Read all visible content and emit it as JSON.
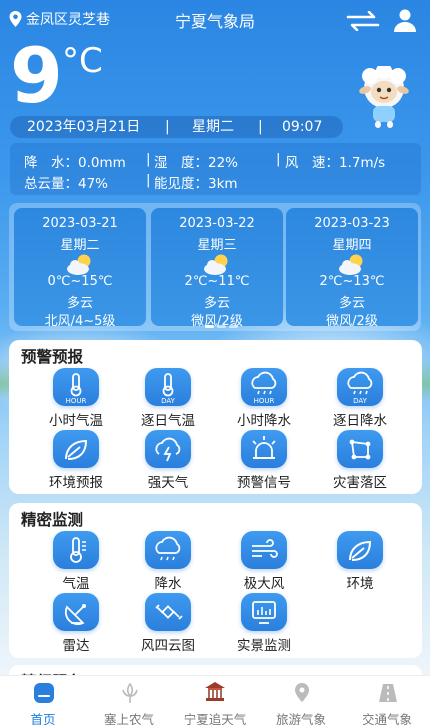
{
  "header": {
    "location": "金凤区灵芝巷",
    "title": "宁夏气象局"
  },
  "current": {
    "temperature": "9",
    "unit": "°C",
    "date": "2023年03月21日",
    "weekday": "星期二",
    "time": "09:07",
    "separator": "|"
  },
  "metrics": {
    "rain": "降　水：0.0mm",
    "humidity": "湿　度：22%",
    "wind": "风　速：1.7m/s",
    "cloud": "总云量：47%",
    "visibility": "能见度：3km",
    "separator": "|"
  },
  "forecast": [
    {
      "date": "2023-03-21",
      "weekday": "星期二",
      "temp": "0℃~15℃",
      "condition": "多云",
      "wind": "北风/4~5级",
      "icon": "partly-cloudy-icon"
    },
    {
      "date": "2023-03-22",
      "weekday": "星期三",
      "temp": "2℃~11℃",
      "condition": "多云",
      "wind": "微风/2级",
      "icon": "partly-cloudy-icon"
    },
    {
      "date": "2023-03-23",
      "weekday": "星期四",
      "temp": "2℃~13℃",
      "condition": "多云",
      "wind": "微风/2级",
      "icon": "partly-cloudy-icon"
    }
  ],
  "warning": {
    "title": "预警预报",
    "items": [
      {
        "label": "小时气温",
        "icon": "hourly-temperature-icon",
        "tag": "HOUR"
      },
      {
        "label": "逐日气温",
        "icon": "daily-temperature-icon",
        "tag": "DAY"
      },
      {
        "label": "小时降水",
        "icon": "hourly-precipitation-icon",
        "tag": "HOUR"
      },
      {
        "label": "逐日降水",
        "icon": "daily-precipitation-icon",
        "tag": "DAY"
      },
      {
        "label": "环境预报",
        "icon": "leaf-icon"
      },
      {
        "label": "强天气",
        "icon": "severe-weather-icon"
      },
      {
        "label": "预警信号",
        "icon": "alarm-light-icon"
      },
      {
        "label": "灾害落区",
        "icon": "disaster-area-icon"
      }
    ]
  },
  "monitor": {
    "title": "精密监测",
    "items": [
      {
        "label": "气温",
        "icon": "thermometer-icon"
      },
      {
        "label": "降水",
        "icon": "rain-cloud-icon"
      },
      {
        "label": "极大风",
        "icon": "wind-icon"
      },
      {
        "label": "环境",
        "icon": "leaf-icon"
      },
      {
        "label": "雷达",
        "icon": "radar-dish-icon"
      },
      {
        "label": "风四云图",
        "icon": "satellite-icon"
      },
      {
        "label": "实景监测",
        "icon": "monitor-screen-icon"
      }
    ]
  },
  "fine_service": {
    "title": "精细服务"
  },
  "nav": [
    {
      "label": "首页",
      "icon": "home-icon",
      "active": true
    },
    {
      "label": "塞上农气",
      "icon": "farm-icon"
    },
    {
      "label": "宁夏追天气",
      "icon": "pavilion-icon"
    },
    {
      "label": "旅游气象",
      "icon": "travel-pin-icon"
    },
    {
      "label": "交通气象",
      "icon": "road-icon"
    }
  ],
  "colors": {
    "primary": "#2a7fdc",
    "sky_top": "#2a86e2",
    "active_nav": "#1f7fe0"
  }
}
